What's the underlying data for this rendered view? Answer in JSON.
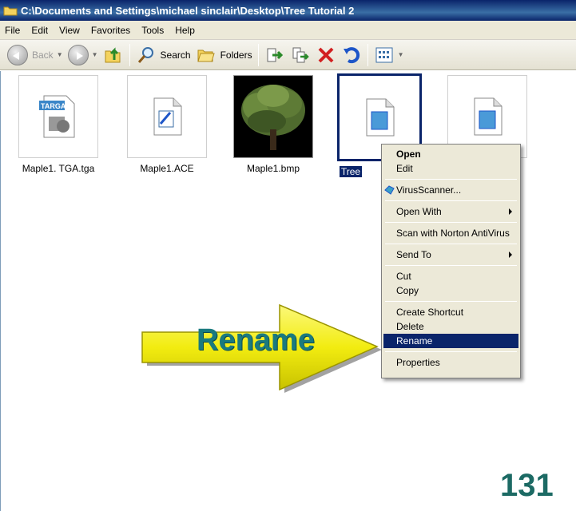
{
  "window": {
    "title": "C:\\Documents and Settings\\michael sinclair\\Desktop\\Tree Tutorial 2"
  },
  "menubar": {
    "items": [
      "File",
      "Edit",
      "View",
      "Favorites",
      "Tools",
      "Help"
    ]
  },
  "toolbar": {
    "back_label": "Back",
    "search_label": "Search",
    "folders_label": "Folders"
  },
  "files": [
    {
      "name": "Maple1. TGA.tga",
      "icon": "targa-file-icon",
      "badge": "TARGA"
    },
    {
      "name": "Maple1.ACE",
      "icon": "ace-file-icon"
    },
    {
      "name": "Maple1.bmp",
      "icon": "tree-thumbnail"
    },
    {
      "name": "Tree",
      "icon": "generic-image-icon",
      "selected": true
    },
    {
      "name": "",
      "icon": "generic-image-icon"
    }
  ],
  "context_menu": {
    "items": [
      {
        "label": "Open",
        "bold": true
      },
      {
        "label": "Edit"
      },
      {
        "label": "VirusScanner...",
        "icon": "virusscanner-icon"
      },
      {
        "label": "Open With",
        "submenu": true
      },
      {
        "label": "Scan with Norton AntiVirus"
      },
      {
        "label": "Send To",
        "submenu": true
      },
      {
        "label": "Cut"
      },
      {
        "label": "Copy"
      },
      {
        "label": "Create Shortcut"
      },
      {
        "label": "Delete"
      },
      {
        "label": "Rename",
        "highlighted": true
      },
      {
        "label": "Properties"
      }
    ]
  },
  "annotation": {
    "arrow_text": "Rename",
    "page_number": "131",
    "arrow_color": "#f5f01a",
    "text_color": "#1a7a7f"
  }
}
